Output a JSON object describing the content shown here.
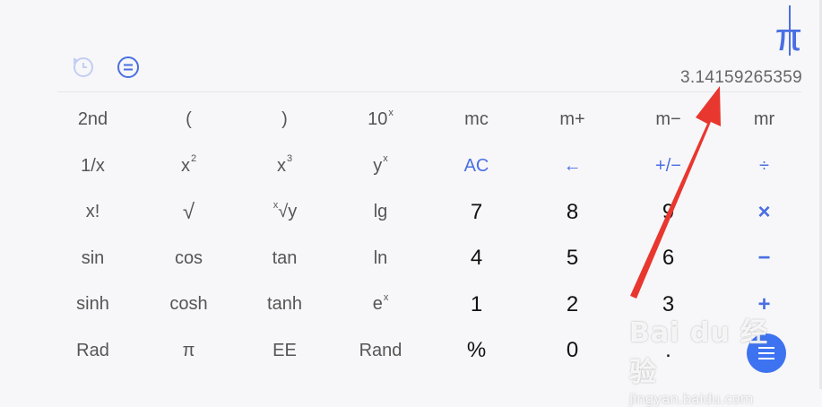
{
  "display": {
    "expression": "π",
    "result": "3.14159265359"
  },
  "toolbar": {
    "history_icon": "history-clock-icon",
    "menu_icon": "equals-menu-icon"
  },
  "keys": {
    "row1": [
      "2nd",
      "(",
      ")",
      "10",
      "mc",
      "m+",
      "m−",
      "mr"
    ],
    "row1_sup": "x",
    "row2": [
      "1/x",
      "x",
      "x",
      "y",
      "AC",
      "←",
      "+/−",
      "÷"
    ],
    "row2_sup": [
      "2",
      "3",
      "x"
    ],
    "row3": [
      "x!",
      "√",
      "√y",
      "lg",
      "7",
      "8",
      "9",
      "×"
    ],
    "row3_sup": "x",
    "row4": [
      "sin",
      "cos",
      "tan",
      "ln",
      "4",
      "5",
      "6",
      "−"
    ],
    "row5": [
      "sinh",
      "cosh",
      "tanh",
      "e",
      "1",
      "2",
      "3",
      "+"
    ],
    "row5_sup": "x",
    "row6": [
      "Rad",
      "π",
      "EE",
      "Rand",
      "%",
      "0",
      "."
    ]
  },
  "fab": {
    "icon": "menu-lines-icon"
  },
  "watermark": {
    "line1": "Bai du 经验",
    "line2": "jingyan.baidu.com"
  },
  "colors": {
    "accent": "#4a6fe3",
    "arrow": "#e8372f",
    "fab": "#3d72f0"
  }
}
